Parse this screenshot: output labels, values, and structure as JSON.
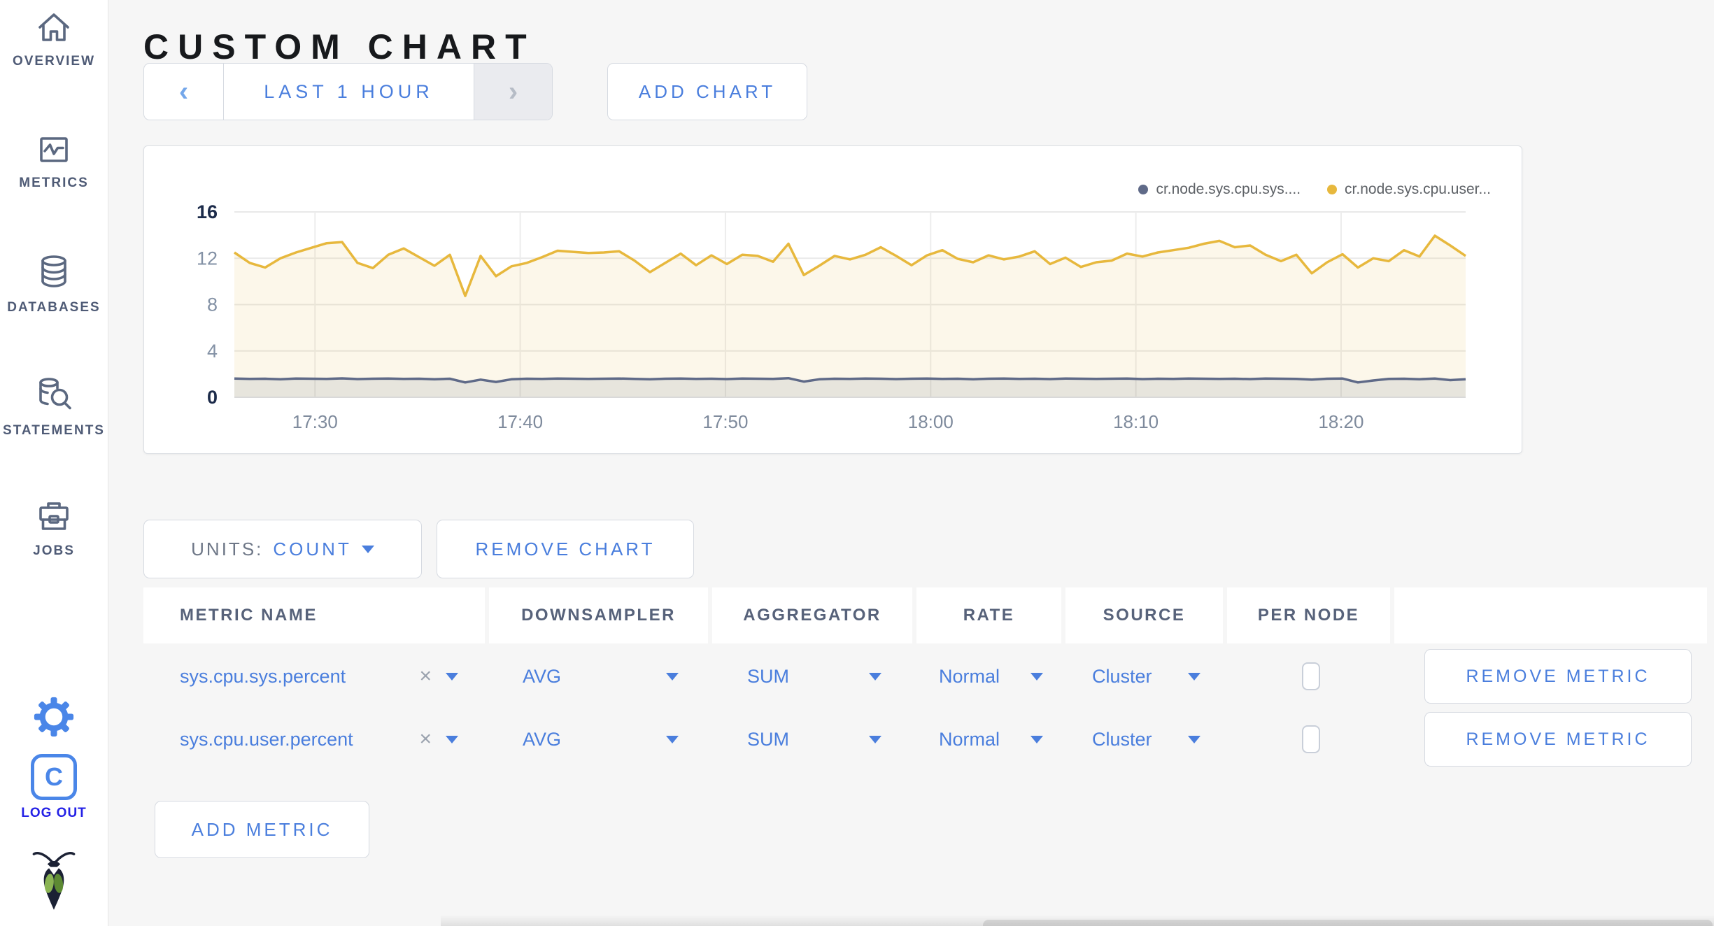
{
  "sidebar": {
    "items": [
      {
        "label": "OVERVIEW",
        "icon": "home-icon"
      },
      {
        "label": "METRICS",
        "icon": "metrics-icon"
      },
      {
        "label": "DATABASES",
        "icon": "database-icon"
      },
      {
        "label": "STATEMENTS",
        "icon": "statements-icon"
      },
      {
        "label": "JOBS",
        "icon": "briefcase-icon"
      }
    ],
    "logout_label": "LOG OUT",
    "logo_letter": "C"
  },
  "header": {
    "title": "CUSTOM CHART"
  },
  "controls": {
    "prev_glyph": "‹",
    "time_window": "LAST 1 HOUR",
    "next_glyph": "›",
    "add_chart_label": "ADD CHART"
  },
  "chart_data": {
    "type": "area",
    "title": "",
    "x_ticks": [
      "17:30",
      "17:40",
      "17:50",
      "18:00",
      "18:10",
      "18:20"
    ],
    "x_domain_minutes": 60,
    "x_first_tick_offset_minutes": 3.93,
    "x_tick_step_minutes": 10,
    "ylim": [
      0,
      16
    ],
    "yticks": [
      0,
      4,
      8,
      12,
      16
    ],
    "grid": true,
    "legend_position": "top-right",
    "series": [
      {
        "name": "cr.node.sys.cpu.sys....",
        "color": "#5f6a88",
        "fill_opacity": 0.13,
        "values": [
          1.62,
          1.58,
          1.6,
          1.56,
          1.62,
          1.6,
          1.58,
          1.63,
          1.57,
          1.6,
          1.62,
          1.58,
          1.6,
          1.55,
          1.6,
          1.28,
          1.52,
          1.32,
          1.55,
          1.6,
          1.58,
          1.62,
          1.6,
          1.58,
          1.6,
          1.62,
          1.58,
          1.55,
          1.6,
          1.62,
          1.58,
          1.6,
          1.57,
          1.62,
          1.6,
          1.58,
          1.65,
          1.35,
          1.55,
          1.6,
          1.58,
          1.62,
          1.6,
          1.57,
          1.6,
          1.62,
          1.58,
          1.6,
          1.56,
          1.6,
          1.62,
          1.58,
          1.6,
          1.57,
          1.62,
          1.6,
          1.58,
          1.6,
          1.62,
          1.57,
          1.6,
          1.58,
          1.62,
          1.6,
          1.58,
          1.6,
          1.57,
          1.62,
          1.6,
          1.58,
          1.52,
          1.6,
          1.62,
          1.28,
          1.45,
          1.58,
          1.6,
          1.56,
          1.62,
          1.48,
          1.55
        ]
      },
      {
        "name": "cr.node.sys.cpu.user...",
        "color": "#e7b83d",
        "fill_opacity": 0.11,
        "values": [
          12.5,
          11.6,
          11.2,
          12.0,
          12.5,
          12.9,
          13.3,
          13.4,
          11.6,
          11.15,
          12.3,
          12.85,
          12.1,
          11.35,
          12.3,
          8.75,
          12.2,
          10.45,
          11.3,
          11.6,
          12.1,
          12.65,
          12.55,
          12.45,
          12.5,
          12.6,
          11.8,
          10.8,
          11.6,
          12.4,
          11.4,
          12.25,
          11.5,
          12.3,
          12.2,
          11.7,
          13.25,
          10.55,
          11.35,
          12.2,
          11.9,
          12.3,
          12.95,
          12.2,
          11.4,
          12.25,
          12.7,
          11.95,
          11.65,
          12.25,
          11.9,
          12.15,
          12.6,
          11.5,
          12.05,
          11.25,
          11.65,
          11.8,
          12.4,
          12.15,
          12.5,
          12.7,
          12.9,
          13.25,
          13.5,
          12.95,
          13.1,
          12.3,
          11.75,
          12.3,
          10.7,
          11.65,
          12.35,
          11.2,
          12.0,
          11.75,
          12.7,
          12.15,
          13.95,
          13.1,
          12.2
        ]
      }
    ]
  },
  "units": {
    "label": "UNITS:",
    "value": "COUNT"
  },
  "remove_chart_label": "REMOVE CHART",
  "table": {
    "columns": [
      {
        "label": "METRIC NAME"
      },
      {
        "label": "DOWNSAMPLER"
      },
      {
        "label": "AGGREGATOR"
      },
      {
        "label": "RATE"
      },
      {
        "label": "SOURCE"
      },
      {
        "label": "PER NODE"
      },
      {
        "label": ""
      }
    ],
    "rows": [
      {
        "metric": "sys.cpu.sys.percent",
        "clear_glyph": "×",
        "downsampler": "AVG",
        "aggregator": "SUM",
        "rate": "Normal",
        "source": "Cluster",
        "per_node_checked": false,
        "remove_label": "REMOVE METRIC"
      },
      {
        "metric": "sys.cpu.user.percent",
        "clear_glyph": "×",
        "downsampler": "AVG",
        "aggregator": "SUM",
        "rate": "Normal",
        "source": "Cluster",
        "per_node_checked": false,
        "remove_label": "REMOVE METRIC"
      }
    ]
  },
  "add_metric_label": "ADD METRIC",
  "colors": {
    "accent_blue": "#4a7edd",
    "icon_blue": "#4a86e8",
    "logout_blue": "#2522e6",
    "sidebar_text": "#4f5b76",
    "series_sys": "#5f6a88",
    "series_user": "#e7b83d"
  }
}
